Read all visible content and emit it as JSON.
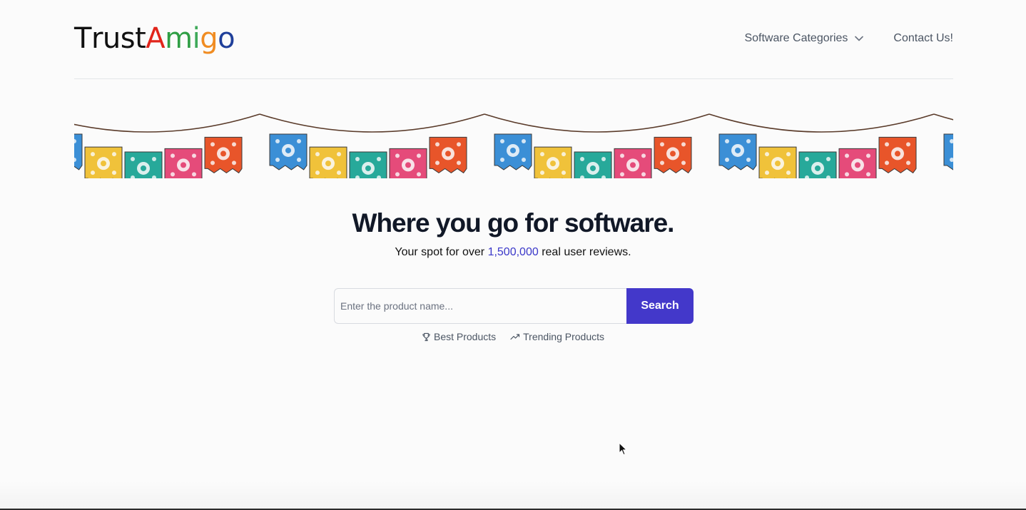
{
  "header": {
    "logo": {
      "letters": [
        {
          "char": "T",
          "color": "#111111"
        },
        {
          "char": "r",
          "color": "#111111"
        },
        {
          "char": "u",
          "color": "#111111"
        },
        {
          "char": "s",
          "color": "#111111"
        },
        {
          "char": "t",
          "color": "#111111"
        },
        {
          "char": "A",
          "color": "#e1251b"
        },
        {
          "char": "m",
          "color": "#2f9e44"
        },
        {
          "char": "i",
          "color": "#3fa95a"
        },
        {
          "char": "g",
          "color": "#f08c22"
        },
        {
          "char": "o",
          "color": "#1f3f9a"
        }
      ]
    },
    "nav": {
      "categories_label": "Software Categories",
      "contact_label": "Contact Us!"
    }
  },
  "banner": {
    "flag_colors": [
      "#3b8fd6",
      "#f0c23a",
      "#27a99a",
      "#e54b7a",
      "#e8552a"
    ]
  },
  "hero": {
    "title": "Where you go for software.",
    "subtitle_pre": "Your spot for over ",
    "subtitle_count": "1,500,000",
    "subtitle_post": " real user reviews."
  },
  "search": {
    "placeholder": "Enter the product name...",
    "button_label": "Search"
  },
  "quick_links": {
    "best_label": "Best Products",
    "trending_label": "Trending Products"
  },
  "colors": {
    "accent": "#4338ca",
    "highlight": "#3b38c9",
    "title": "#111827"
  }
}
